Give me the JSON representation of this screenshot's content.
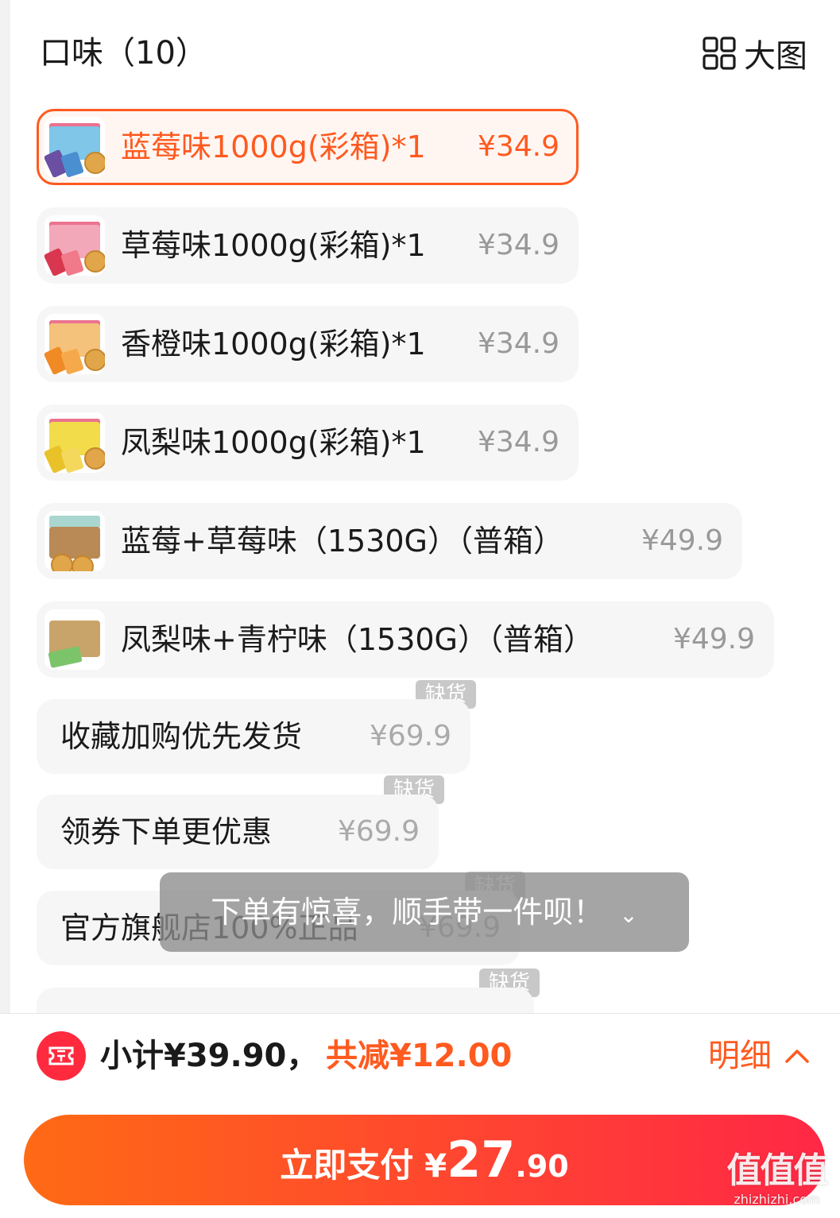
{
  "header": {
    "title": "口味（10）",
    "big_view_label": "大图",
    "big_view_icon": "grid-icon"
  },
  "options": [
    {
      "name": "蓝莓味1000g(彩箱)*1",
      "price": "¥34.9",
      "selected": true,
      "thumb_color": "#7fc6e8"
    },
    {
      "name": "草莓味1000g(彩箱)*1",
      "price": "¥34.9",
      "selected": false,
      "thumb_color": "#f2a8b8"
    },
    {
      "name": "香橙味1000g(彩箱)*1",
      "price": "¥34.9",
      "selected": false,
      "thumb_color": "#f4c27a"
    },
    {
      "name": "凤梨味1000g(彩箱)*1",
      "price": "¥34.9",
      "selected": false,
      "thumb_color": "#f2dc4a"
    },
    {
      "name": "蓝莓+草莓味（1530G）（普箱）",
      "price": "¥49.9",
      "selected": false,
      "thumb_color": "#b98a55"
    },
    {
      "name": "凤梨味+青柠味（1530G）（普箱）",
      "price": "¥49.9",
      "selected": false,
      "thumb_color": "#c9a46a"
    },
    {
      "name": "收藏加购优先发货",
      "price": "¥69.9",
      "out_of_stock": true
    },
    {
      "name": "领券下单更优惠",
      "price": "¥69.9",
      "out_of_stock": true
    },
    {
      "name": "官方旗舰店100%正品",
      "price": "¥69.9",
      "out_of_stock": true
    },
    {
      "name": "",
      "price": "",
      "out_of_stock": true
    }
  ],
  "out_of_stock_label": "缺货",
  "toast": {
    "text": "下单有惊喜，顺手带一件呗！",
    "icon": "double-chevron-down-icon"
  },
  "footer": {
    "subtotal": "小计¥39.90，",
    "discount": "共减¥12.00",
    "detail_label": "明细",
    "coupon_icon": "ticket-icon",
    "pay_label": "立即支付",
    "pay_currency": "¥",
    "pay_integer": "27",
    "pay_decimal": ".90"
  },
  "watermark": {
    "logo": "值值值",
    "url": "zhizhizhi.com"
  },
  "colors": {
    "accent": "#ff5a1f",
    "pay_gradient_start": "#ff6a15",
    "pay_gradient_end": "#ff2746",
    "out_of_stock_badge": "#c8c8c8"
  }
}
